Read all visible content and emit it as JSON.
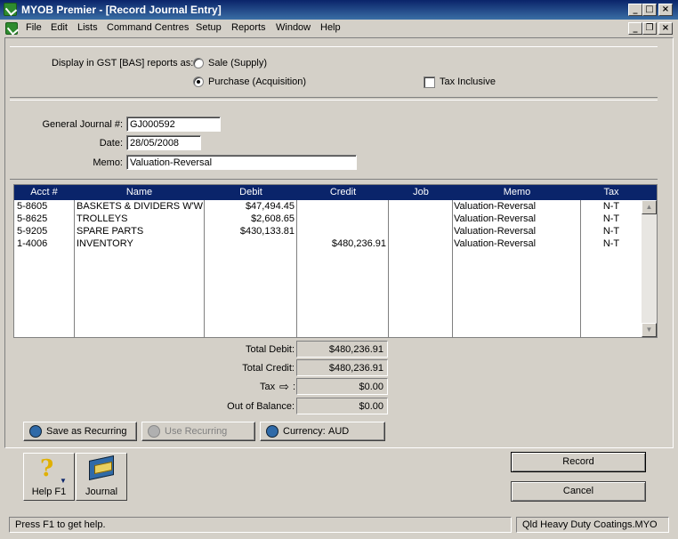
{
  "window": {
    "title": "MYOB Premier - [Record Journal Entry]"
  },
  "menu": [
    "File",
    "Edit",
    "Lists",
    "Command Centres",
    "Setup",
    "Reports",
    "Window",
    "Help"
  ],
  "gst": {
    "label": "Display in GST [BAS] reports as:",
    "sale_label": "Sale (Supply)",
    "purchase_label": "Purchase (Acquisition)",
    "selected": "purchase",
    "tax_inclusive_label": "Tax Inclusive",
    "tax_inclusive_checked": false
  },
  "header": {
    "journal_label": "General Journal #:",
    "journal_value": "GJ000592",
    "date_label": "Date:",
    "date_value": "28/05/2008",
    "memo_label": "Memo:",
    "memo_value": "Valuation-Reversal"
  },
  "grid": {
    "columns": [
      "Acct #",
      "Name",
      "Debit",
      "Credit",
      "Job",
      "Memo",
      "Tax"
    ],
    "rows": [
      {
        "acct": "5-8605",
        "name": "BASKETS & DIVIDERS W'WI",
        "debit": "$47,494.45",
        "credit": "",
        "job": "",
        "memo": "Valuation-Reversal",
        "tax": "N-T"
      },
      {
        "acct": "5-8625",
        "name": "TROLLEYS",
        "debit": "$2,608.65",
        "credit": "",
        "job": "",
        "memo": "Valuation-Reversal",
        "tax": "N-T"
      },
      {
        "acct": "5-9205",
        "name": "SPARE PARTS",
        "debit": "$430,133.81",
        "credit": "",
        "job": "",
        "memo": "Valuation-Reversal",
        "tax": "N-T"
      },
      {
        "acct": "1-4006",
        "name": "INVENTORY",
        "debit": "",
        "credit": "$480,236.91",
        "job": "",
        "memo": "Valuation-Reversal",
        "tax": "N-T"
      }
    ]
  },
  "totals": {
    "debit_label": "Total Debit:",
    "debit": "$480,236.91",
    "credit_label": "Total Credit:",
    "credit": "$480,236.91",
    "tax_label": "Tax",
    "tax_arrow": "⇨",
    "tax_colon": ":",
    "tax": "$0.00",
    "balance_label": "Out of Balance:",
    "balance": "$0.00"
  },
  "buttons": {
    "save_recurring": "Save as Recurring",
    "use_recurring": "Use Recurring",
    "currency_label": "Currency:",
    "currency_value": "AUD",
    "help": "Help F1",
    "journal": "Journal",
    "record": "Record",
    "cancel": "Cancel"
  },
  "status": {
    "help_text": "Press F1 to get help.",
    "company": "Qld Heavy Duty Coatings.MYO"
  },
  "colors": {
    "title_bar": "#0a246a",
    "grid_header": "#0a246a",
    "face": "#d4d0c8"
  }
}
